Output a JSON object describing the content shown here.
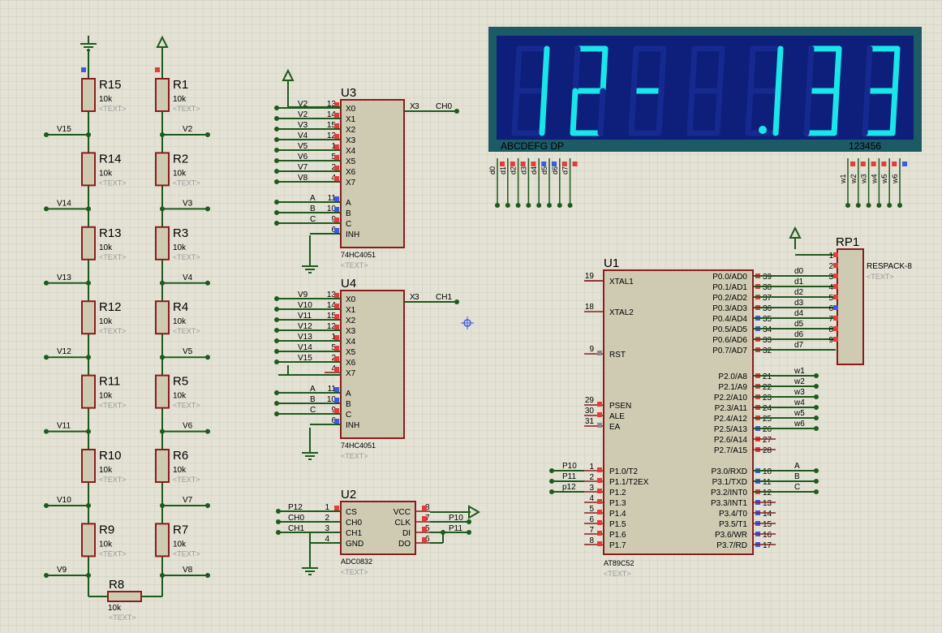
{
  "display": {
    "digits": [
      "1",
      "2",
      "-",
      "",
      "1",
      "3",
      "3"
    ],
    "dp_after_digit_index": 4,
    "left_label": "ABCDEFG  DP",
    "right_label": "123456",
    "seg_pins": [
      "d0",
      "d1",
      "d2",
      "d3",
      "d4",
      "d5",
      "d6",
      "d7"
    ],
    "dig_pins": [
      "w1",
      "w2",
      "w3",
      "w4",
      "w5",
      "w6"
    ],
    "colors": {
      "bezel": "#1c5a66",
      "panel": "#0d1f7a",
      "segment_on": "#19e6ea",
      "segment_off": "#16298f"
    }
  },
  "divider": {
    "left": [
      {
        "ref": "R15",
        "value": "10k",
        "text": "<TEXT>",
        "tap": "V15"
      },
      {
        "ref": "R14",
        "value": "10k",
        "text": "<TEXT>",
        "tap": "V14"
      },
      {
        "ref": "R13",
        "value": "10k",
        "text": "<TEXT>",
        "tap": "V13"
      },
      {
        "ref": "R12",
        "value": "10k",
        "text": "<TEXT>",
        "tap": "V12"
      },
      {
        "ref": "R11",
        "value": "10k",
        "text": "<TEXT>",
        "tap": "V11"
      },
      {
        "ref": "R10",
        "value": "10k",
        "text": "<TEXT>",
        "tap": "V10"
      },
      {
        "ref": "R9",
        "value": "10k",
        "text": "<TEXT>",
        "tap": "V9"
      }
    ],
    "right": [
      {
        "ref": "R1",
        "value": "10k",
        "text": "<TEXT>",
        "tap": "V2"
      },
      {
        "ref": "R2",
        "value": "10k",
        "text": "<TEXT>",
        "tap": "V3"
      },
      {
        "ref": "R3",
        "value": "10k",
        "text": "<TEXT>",
        "tap": "V4"
      },
      {
        "ref": "R4",
        "value": "10k",
        "text": "<TEXT>",
        "tap": "V5"
      },
      {
        "ref": "R5",
        "value": "10k",
        "text": "<TEXT>",
        "tap": "V6"
      },
      {
        "ref": "R6",
        "value": "10k",
        "text": "<TEXT>",
        "tap": "V7"
      },
      {
        "ref": "R7",
        "value": "10k",
        "text": "<TEXT>",
        "tap": "V8"
      }
    ],
    "bottom": {
      "ref": "R8",
      "value": "10k",
      "text": "<TEXT>"
    }
  },
  "u3": {
    "ref": "U3",
    "part": "74HC4051",
    "text": "<TEXT>",
    "inputs": [
      {
        "net": "V2",
        "pin": "13",
        "name": "X0"
      },
      {
        "net": "V2",
        "pin": "14",
        "name": "X1"
      },
      {
        "net": "V3",
        "pin": "15",
        "name": "X2"
      },
      {
        "net": "V4",
        "pin": "12",
        "name": "X3"
      },
      {
        "net": "V5",
        "pin": "1",
        "name": "X4"
      },
      {
        "net": "V6",
        "pin": "5",
        "name": "X5"
      },
      {
        "net": "V7",
        "pin": "2",
        "name": "X6"
      },
      {
        "net": "V8",
        "pin": "4",
        "name": "X7"
      }
    ],
    "ctrl": [
      {
        "net": "A",
        "pin": "11",
        "name": "A"
      },
      {
        "net": "B",
        "pin": "10",
        "name": "B"
      },
      {
        "net": "C",
        "pin": "9",
        "name": "C"
      },
      {
        "net": "",
        "pin": "6",
        "name": "INH"
      }
    ],
    "out": {
      "name": "X",
      "pin": "3",
      "net": "CH0"
    }
  },
  "u4": {
    "ref": "U4",
    "part": "74HC4051",
    "text": "<TEXT>",
    "inputs": [
      {
        "net": "V9",
        "pin": "13",
        "name": "X0"
      },
      {
        "net": "V10",
        "pin": "14",
        "name": "X1"
      },
      {
        "net": "V11",
        "pin": "15",
        "name": "X2"
      },
      {
        "net": "V12",
        "pin": "12",
        "name": "X3"
      },
      {
        "net": "V13",
        "pin": "1",
        "name": "X4"
      },
      {
        "net": "V14",
        "pin": "5",
        "name": "X5"
      },
      {
        "net": "V15",
        "pin": "2",
        "name": "X6"
      },
      {
        "net": "",
        "pin": "4",
        "name": "X7"
      }
    ],
    "ctrl": [
      {
        "net": "A",
        "pin": "11",
        "name": "A"
      },
      {
        "net": "B",
        "pin": "10",
        "name": "B"
      },
      {
        "net": "C",
        "pin": "9",
        "name": "C"
      },
      {
        "net": "",
        "pin": "6",
        "name": "INH"
      }
    ],
    "out": {
      "name": "X",
      "pin": "3",
      "net": "CH1"
    }
  },
  "u2": {
    "ref": "U2",
    "part": "ADC0832",
    "text": "<TEXT>",
    "left": [
      {
        "net": "P12",
        "pin": "1",
        "name": "CS"
      },
      {
        "net": "CH0",
        "pin": "2",
        "name": "CH0"
      },
      {
        "net": "CH1",
        "pin": "3",
        "name": "CH1"
      },
      {
        "net": "",
        "pin": "4",
        "name": "GND"
      }
    ],
    "right": [
      {
        "name": "VCC",
        "pin": "8",
        "net": ""
      },
      {
        "name": "CLK",
        "pin": "7",
        "net": "P10"
      },
      {
        "name": "DI",
        "pin": "5",
        "net": "P11"
      },
      {
        "name": "DO",
        "pin": "6",
        "net": ""
      }
    ]
  },
  "u1": {
    "ref": "U1",
    "part": "AT89C52",
    "text": "<TEXT>",
    "left_top": [
      {
        "pin": "19",
        "name": "XTAL1"
      },
      {
        "pin": "18",
        "name": "XTAL2"
      },
      {
        "pin": "9",
        "name": "RST"
      },
      {
        "pin": "29",
        "name": "PSEN"
      },
      {
        "pin": "30",
        "name": "ALE"
      },
      {
        "pin": "31",
        "name": "EA"
      }
    ],
    "p1": [
      {
        "pin": "1",
        "name": "P1.0/T2",
        "net": "P10"
      },
      {
        "pin": "2",
        "name": "P1.1/T2EX",
        "net": "P11"
      },
      {
        "pin": "3",
        "name": "P1.2",
        "net": "p12"
      },
      {
        "pin": "4",
        "name": "P1.3",
        "net": ""
      },
      {
        "pin": "5",
        "name": "P1.4",
        "net": ""
      },
      {
        "pin": "6",
        "name": "P1.5",
        "net": ""
      },
      {
        "pin": "7",
        "name": "P1.6",
        "net": ""
      },
      {
        "pin": "8",
        "name": "P1.7",
        "net": ""
      }
    ],
    "p0": [
      {
        "pin": "39",
        "name": "P0.0/AD0",
        "net": "d0"
      },
      {
        "pin": "38",
        "name": "P0.1/AD1",
        "net": "d1"
      },
      {
        "pin": "37",
        "name": "P0.2/AD2",
        "net": "d2"
      },
      {
        "pin": "36",
        "name": "P0.3/AD3",
        "net": "d3"
      },
      {
        "pin": "35",
        "name": "P0.4/AD4",
        "net": "d4"
      },
      {
        "pin": "34",
        "name": "P0.5/AD5",
        "net": "d5"
      },
      {
        "pin": "33",
        "name": "P0.6/AD6",
        "net": "d6"
      },
      {
        "pin": "32",
        "name": "P0.7/AD7",
        "net": "d7"
      }
    ],
    "p2": [
      {
        "pin": "21",
        "name": "P2.0/A8",
        "net": "w1"
      },
      {
        "pin": "22",
        "name": "P2.1/A9",
        "net": "w2"
      },
      {
        "pin": "23",
        "name": "P2.2/A10",
        "net": "w3"
      },
      {
        "pin": "24",
        "name": "P2.3/A11",
        "net": "w4"
      },
      {
        "pin": "25",
        "name": "P2.4/A12",
        "net": "w5"
      },
      {
        "pin": "26",
        "name": "P2.5/A13",
        "net": "w6"
      },
      {
        "pin": "27",
        "name": "P2.6/A14",
        "net": ""
      },
      {
        "pin": "28",
        "name": "P2.7/A15",
        "net": ""
      }
    ],
    "p3": [
      {
        "pin": "10",
        "name": "P3.0/RXD",
        "net": "A"
      },
      {
        "pin": "11",
        "name": "P3.1/TXD",
        "net": "B"
      },
      {
        "pin": "12",
        "name": "P3.2/INT0",
        "net": "C"
      },
      {
        "pin": "13",
        "name": "P3.3/INT1",
        "net": ""
      },
      {
        "pin": "14",
        "name": "P3.4/T0",
        "net": ""
      },
      {
        "pin": "15",
        "name": "P3.5/T1",
        "net": ""
      },
      {
        "pin": "16",
        "name": "P3.6/WR",
        "net": ""
      },
      {
        "pin": "17",
        "name": "P3.7/RD",
        "net": ""
      }
    ]
  },
  "rp1": {
    "ref": "RP1",
    "part": "RESPACK-8",
    "text": "<TEXT>",
    "pins": [
      "1",
      "2",
      "3",
      "4",
      "5",
      "6",
      "7",
      "8",
      "9"
    ]
  }
}
